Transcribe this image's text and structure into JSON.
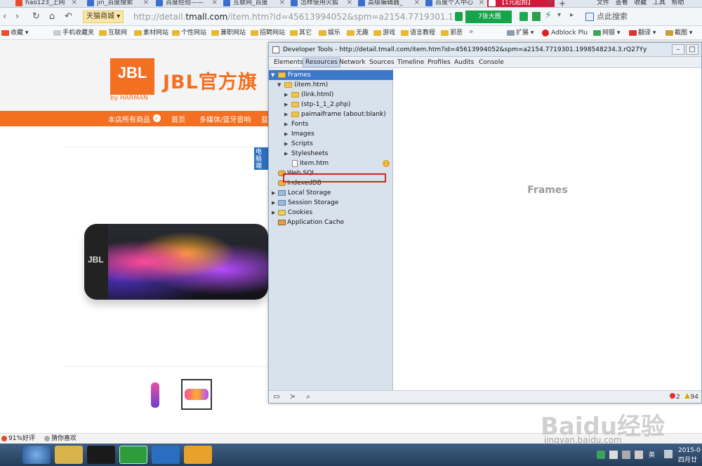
{
  "browser": {
    "tabs": [
      {
        "label": "hao123_上网",
        "active": false
      },
      {
        "label": "jin_百度搜索",
        "active": false
      },
      {
        "label": "百度经验——",
        "active": false
      },
      {
        "label": "互联网_百度",
        "active": false
      },
      {
        "label": "怎样使用火狐",
        "active": false
      },
      {
        "label": "高级编辑器_",
        "active": false
      },
      {
        "label": "百度个人中心",
        "active": false
      },
      {
        "label": "【1元起拍】",
        "active": true
      }
    ],
    "new_tab": "+",
    "menu": [
      "文件",
      "查看",
      "收藏",
      "工具",
      "帮助"
    ],
    "site_chip": "天猫商城",
    "url_prefix": "http://detail.",
    "url_host": "tmall.com",
    "url_rest": "/item.htm?id=45613994052&spm=a2154.7719301.19985482",
    "big_pic_label": "7张大图",
    "search_placeholder": "点此搜索",
    "bookmarks": [
      "收藏",
      "手机收藏夹",
      "互联网",
      "素材网站",
      "个性网站",
      "兼职网站",
      "招聘网站",
      "其它",
      "娱乐",
      "无趣",
      "游戏",
      "语言教程",
      "邪恶"
    ],
    "extensions": [
      "扩展",
      "Adblock Plu",
      "网银",
      "翻译",
      "截图"
    ]
  },
  "store": {
    "logo_text": "JBL",
    "logo_sub": "by HARMAN",
    "title": "JBL官方旗",
    "nav": [
      "本店所有商品",
      "首页",
      "多媒体/蓝牙音响",
      "蓝"
    ],
    "tag_text": "电脑端",
    "product_logo": "JBL",
    "rating": "91%好评",
    "guess": "猜你喜欢"
  },
  "devtools": {
    "window_title": "Developer Tools - http://detail.tmall.com/item.htm?id=45613994052&spm=a2154.7719301.1998548234.3.rQ27Yy",
    "tabs": [
      {
        "label": "Elements",
        "active": false
      },
      {
        "label": "Resources",
        "active": true
      },
      {
        "label": "Network",
        "active": false
      },
      {
        "label": "Sources",
        "active": false
      },
      {
        "label": "Timeline",
        "active": false
      },
      {
        "label": "Profiles",
        "active": false
      },
      {
        "label": "Audits",
        "active": false
      },
      {
        "label": "Console",
        "active": false
      }
    ],
    "tree": [
      {
        "label": "Frames",
        "depth": 0,
        "icon": "folder-icon",
        "expanded": true,
        "selected": true
      },
      {
        "label": "(item.htm)",
        "depth": 1,
        "icon": "folder-icon",
        "expanded": true
      },
      {
        "label": "(link.html)",
        "depth": 2,
        "icon": "folder-icon",
        "expanded": false
      },
      {
        "label": "(stp-1_1_2.php)",
        "depth": 2,
        "icon": "folder-icon",
        "expanded": false
      },
      {
        "label": "paimaiframe (about:blank)",
        "depth": 2,
        "icon": "folder-icon",
        "expanded": false
      },
      {
        "label": "Fonts",
        "depth": 2,
        "icon": "",
        "expanded": false
      },
      {
        "label": "Images",
        "depth": 2,
        "icon": "",
        "expanded": false,
        "highlighted": true
      },
      {
        "label": "Scripts",
        "depth": 2,
        "icon": "",
        "expanded": false
      },
      {
        "label": "Stylesheets",
        "depth": 2,
        "icon": "",
        "expanded": false
      },
      {
        "label": "item.htm",
        "depth": 2,
        "icon": "file-icon",
        "badge": "1"
      },
      {
        "label": "Web SQL",
        "depth": 0,
        "icon": "database-icon"
      },
      {
        "label": "IndexedDB",
        "depth": 0,
        "icon": "database-icon"
      },
      {
        "label": "Local Storage",
        "depth": 0,
        "icon": "grid-icon",
        "expanded": false
      },
      {
        "label": "Session Storage",
        "depth": 0,
        "icon": "grid-icon",
        "expanded": false
      },
      {
        "label": "Cookies",
        "depth": 0,
        "icon": "cookie-icon",
        "expanded": false
      },
      {
        "label": "Application Cache",
        "depth": 0,
        "icon": "cache-icon"
      }
    ],
    "main_placeholder": "Frames",
    "error_count": "2",
    "warning_count": "94"
  },
  "taskbar": {
    "tray_lang": "英",
    "date": "2015-0",
    "weekday": "四月廿"
  },
  "watermark": {
    "brand": "Baidu经验",
    "url": "jingyan.baidu.com"
  },
  "colors": {
    "jbl_orange": "#f36f21",
    "selection_blue": "#3c78c9",
    "annotation_red": "#d4241c"
  }
}
